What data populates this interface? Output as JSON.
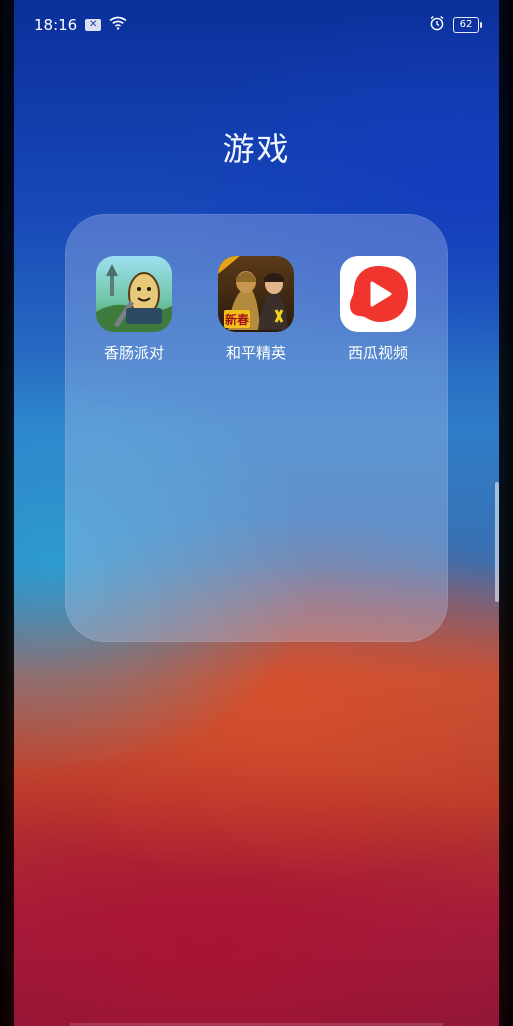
{
  "status_bar": {
    "time": "18:16",
    "battery": "62"
  },
  "folder": {
    "title": "游戏",
    "apps": [
      {
        "label": "香肠派对",
        "icon": "sausage-party-icon"
      },
      {
        "label": "和平精英",
        "icon": "peace-elite-icon"
      },
      {
        "label": "西瓜视频",
        "icon": "xigua-video-icon"
      }
    ]
  },
  "icon_texts": {
    "peace_elite_badge": "新春"
  },
  "colors": {
    "xigua_red": "#f0352e",
    "panel": "rgba(190,205,240,0.32)"
  }
}
